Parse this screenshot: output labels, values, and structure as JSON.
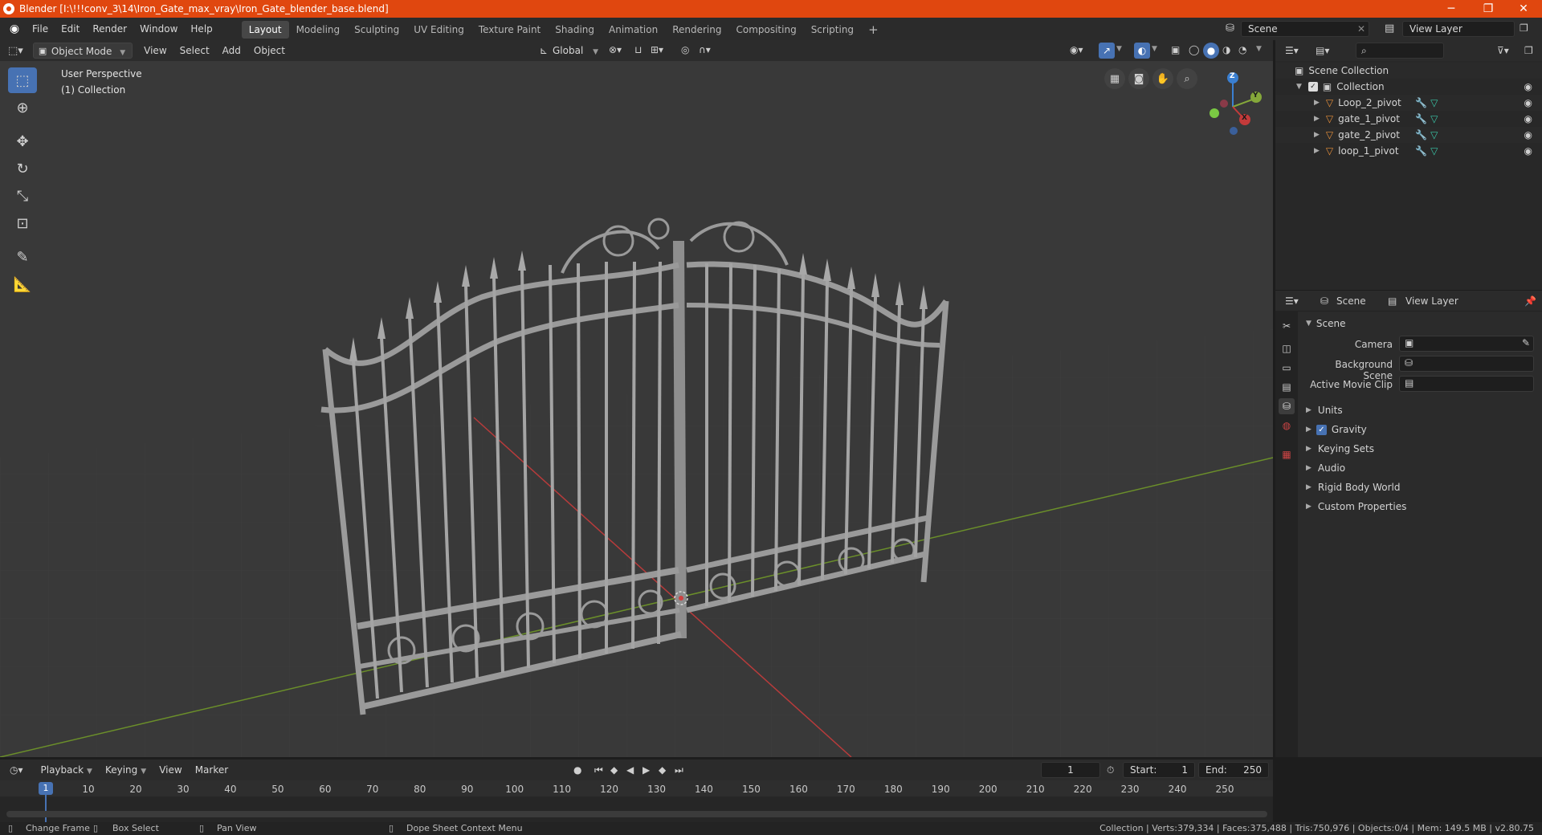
{
  "window": {
    "title": "Blender [I:\\!!!conv_3\\14\\Iron_Gate_max_vray\\Iron_Gate_blender_base.blend]",
    "minimize": "─",
    "maximize": "❐",
    "close": "✕"
  },
  "menu": [
    "File",
    "Edit",
    "Render",
    "Window",
    "Help"
  ],
  "workspaces": [
    "Layout",
    "Modeling",
    "Sculpting",
    "UV Editing",
    "Texture Paint",
    "Shading",
    "Animation",
    "Rendering",
    "Compositing",
    "Scripting"
  ],
  "add_workspace": "+",
  "scene_selector": "Scene",
  "view_layer_selector": "View Layer",
  "viewport": {
    "mode": "Object Mode",
    "menus": [
      "View",
      "Select",
      "Add",
      "Object"
    ],
    "transform_orientation": "Global",
    "perspective": "User Perspective",
    "collection": "(1) Collection",
    "gizmo": {
      "x": "X",
      "y": "Y",
      "z": "Z"
    }
  },
  "outliner": {
    "root": "Scene Collection",
    "collection": "Collection",
    "objects": [
      "Loop_2_pivot",
      "gate_1_pivot",
      "gate_2_pivot",
      "loop_1_pivot"
    ]
  },
  "properties": {
    "tab_scene": "Scene",
    "tab_view_layer": "View Layer",
    "panel_title": "Scene",
    "camera_label": "Camera",
    "background_scene_label": "Background Scene",
    "active_movie_clip_label": "Active Movie Clip",
    "sections": [
      "Units",
      "Gravity",
      "Keying Sets",
      "Audio",
      "Rigid Body World",
      "Custom Properties"
    ],
    "gravity_enabled": true
  },
  "timeline": {
    "menus": [
      "Playback",
      "Keying",
      "View",
      "Marker"
    ],
    "current_frame": "1",
    "start_label": "Start:",
    "start": "1",
    "end_label": "End:",
    "end": "250",
    "ticks": [
      "1",
      "10",
      "20",
      "30",
      "40",
      "50",
      "60",
      "70",
      "80",
      "90",
      "100",
      "110",
      "120",
      "130",
      "140",
      "150",
      "160",
      "170",
      "180",
      "190",
      "200",
      "210",
      "220",
      "230",
      "240",
      "250"
    ]
  },
  "statusbar": {
    "change_frame": "Change Frame",
    "box_select": "Box Select",
    "pan_view": "Pan View",
    "context_menu": "Dope Sheet Context Menu",
    "stats": "Collection | Verts:379,334 | Faces:375,488 | Tris:750,976 | Objects:0/4 | Mem: 149.5 MB | v2.80.75"
  },
  "colors": {
    "title_bar": "#e0470f",
    "accent": "#4772b3",
    "x_axis": "#b83b3b",
    "y_axis": "#6b8f2a",
    "object_icon": "#e8903a",
    "modifier_icon": "#5aa9e6",
    "mesh_icon": "#3ac6a8"
  }
}
